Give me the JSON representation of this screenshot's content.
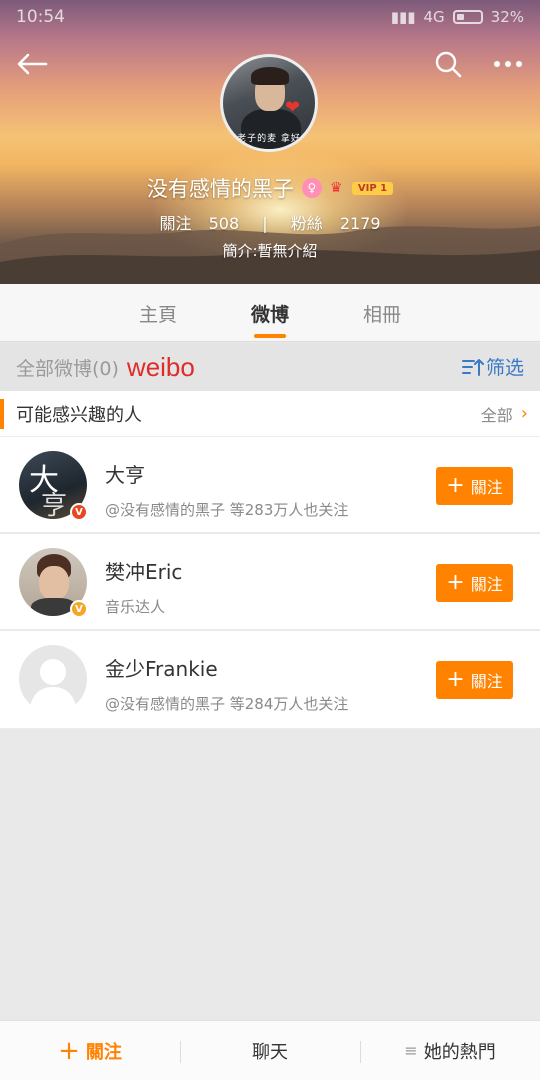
{
  "status_bar": {
    "time": "10:54",
    "network": "4G",
    "battery": "32%"
  },
  "profile": {
    "avatar_caption": "老子的麦  拿好",
    "name": "没有感情的黑子",
    "vip_label": "VIP 1",
    "following_label": "關注",
    "following_count": "508",
    "followers_label": "粉絲",
    "followers_count": "2179",
    "bio": "簡介:暫無介紹"
  },
  "tabs": [
    {
      "label": "主頁",
      "active": false
    },
    {
      "label": "微博",
      "active": true
    },
    {
      "label": "相冊",
      "active": false
    }
  ],
  "filter_bar": {
    "all_label": "全部微博(0)",
    "annotation": "weibo",
    "filter_label": "筛选"
  },
  "suggestions": {
    "title": "可能感兴趣的人",
    "all_link": "全部",
    "people": [
      {
        "name": "大亨",
        "sub": "@没有感情的黑子 等283万人也关注",
        "follow_label": "關注",
        "verify_color": "#e8461f"
      },
      {
        "name": "樊冲Eric",
        "sub": "音乐达人",
        "follow_label": "關注",
        "verify_color": "#f5a623"
      },
      {
        "name": "金少Frankie",
        "sub": "@没有感情的黑子 等284万人也关注",
        "follow_label": "關注"
      }
    ]
  },
  "bottom_bar": {
    "follow_label": "關注",
    "chat_label": "聊天",
    "hot_label": "她的熱門"
  },
  "colors": {
    "accent": "#ff8200",
    "link_blue": "#3a79c6",
    "annotation_red": "#e02b2b"
  }
}
